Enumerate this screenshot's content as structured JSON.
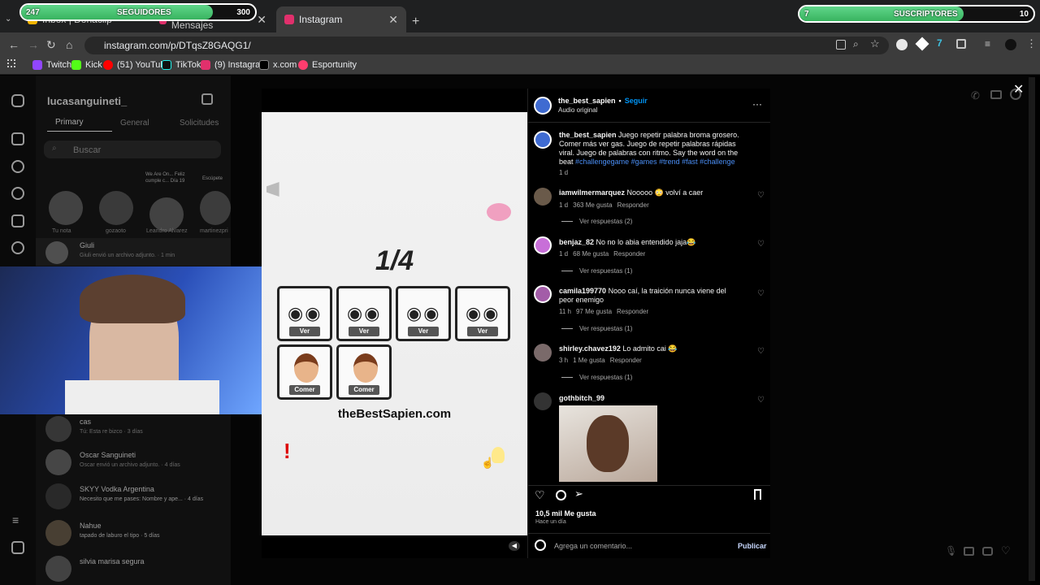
{
  "browser": {
    "tabs": [
      {
        "label": "Inbox | Dohaclip"
      },
      {
        "label": "(9) Instagram • Mensajes"
      },
      {
        "label": "Instagram"
      }
    ],
    "url": "instagram.com/p/DTqsZ8GAQG1/",
    "bookmarks": [
      "Twitch",
      "Kick",
      "(51) YouTube",
      "TikTok",
      "(9) Instagram",
      "x.com",
      "Esportunity"
    ]
  },
  "overlay": {
    "followers": {
      "label": "SEGUIDORES",
      "current": "247",
      "goal": "300",
      "progress": 0.82
    },
    "subscribers": {
      "label": "SUSCRIPTORES",
      "current": "7",
      "goal": "10",
      "progress": 0.7
    }
  },
  "dm": {
    "username": "lucasanguineti_",
    "tabs": [
      "Primary",
      "General",
      "Solicitudes"
    ],
    "search_placeholder": "Buscar",
    "notes": [
      {
        "title": "",
        "name": "Tu nota"
      },
      {
        "title": "",
        "name": "gozaoto"
      },
      {
        "title": "We Are On... Feliz cumple c... Día 19",
        "name": "Leandro Alvarez"
      },
      {
        "title": "Escúpete",
        "name": "martinezpri"
      }
    ],
    "threads": [
      {
        "name": "Giuli",
        "preview": "Giuli envió un archivo adjunto. · 1 min"
      },
      {
        "name": "cas",
        "preview": "Tú: Esta re bizco · 3 días"
      },
      {
        "name": "Oscar Sanguineti",
        "preview": "Oscar envió un archivo adjunto. · 4 días"
      },
      {
        "name": "SKYY Vodka Argentina",
        "preview": "Necesito que me pases: Nombre y ape... · 4 días"
      },
      {
        "name": "Nahue",
        "preview": "tapado de laburo el tipo · 5 días"
      },
      {
        "name": "silvia marisa segura",
        "preview": ""
      }
    ]
  },
  "video": {
    "counter": "1/4",
    "cards_top": [
      "Ver",
      "Ver",
      "Ver",
      "Ver"
    ],
    "cards_bottom": [
      "Comer",
      "Comer"
    ],
    "site": "theBestSapien.com"
  },
  "post": {
    "author": "the_best_sapien",
    "follow": "Seguir",
    "audio": "Audio original",
    "caption_text": "Juego repetir palabra broma grosero. Comer más ver gas. Juego de repetir palabras rápidas viral. Juego de palabras con ritmo. Say the word on the beat",
    "caption_tags": "#challengegame #games #trend #fast #challenge",
    "caption_time": "1 d",
    "comments": [
      {
        "user": "iamwilmermarquez",
        "text": "Nooooo 😳 volví a caer",
        "time": "1 d",
        "likes": "363 Me gusta",
        "reply": "Responder",
        "replies": "Ver respuestas (2)"
      },
      {
        "user": "benjaz_82",
        "text": "No no lo abia entendido jaja😂",
        "time": "1 d",
        "likes": "68 Me gusta",
        "reply": "Responder",
        "replies": "Ver respuestas (1)"
      },
      {
        "user": "camila199770",
        "text": "Nooo caí, la traición nunca viene del peor enemigo",
        "time": "11 h",
        "likes": "97 Me gusta",
        "reply": "Responder",
        "replies": "Ver respuestas (1)"
      },
      {
        "user": "shirley.chavez192",
        "text": "Lo admito cai 😂",
        "time": "3 h",
        "likes": "1 Me gusta",
        "reply": "Responder",
        "replies": "Ver respuestas (1)"
      },
      {
        "user": "gothbitch_99",
        "text": "",
        "time": "",
        "likes": "",
        "reply": "",
        "replies": ""
      }
    ],
    "likes": "10,5 mil Me gusta",
    "when": "Hace un día",
    "comment_placeholder": "Agrega un comentario...",
    "publish": "Publicar"
  },
  "colors": {
    "accent": "#0095f6",
    "overlay_green": "#45c46e"
  }
}
